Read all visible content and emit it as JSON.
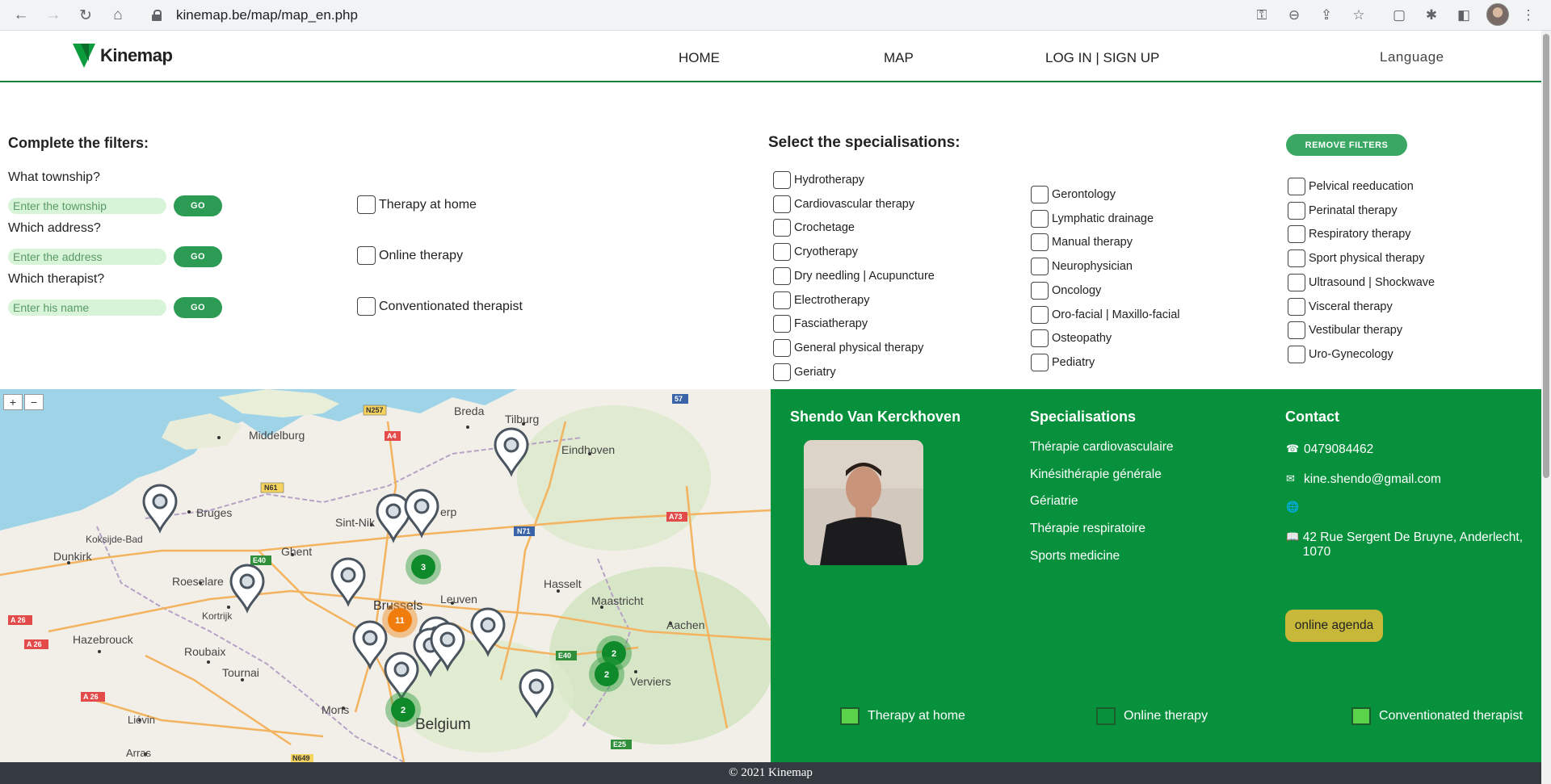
{
  "browser": {
    "url": "kinemap.be/map/map_en.php"
  },
  "header": {
    "logo_text": "Kinemap",
    "nav": [
      "HOME",
      "MAP",
      "LOG IN | SIGN UP"
    ],
    "language": "Language"
  },
  "filters": {
    "title": "Complete the filters:",
    "township_label": "What township?",
    "township_placeholder": "Enter the township",
    "address_label": "Which address?",
    "address_placeholder": "Enter the address",
    "therapist_label": "Which therapist?",
    "therapist_placeholder": "Enter his name",
    "go_label": "GO",
    "options": [
      "Therapy at home",
      "Online therapy",
      "Conventionated therapist"
    ]
  },
  "specialisations": {
    "title": "Select the specialisations:",
    "remove_label": "REMOVE FILTERS",
    "col1": [
      "Hydrotherapy",
      "Cardiovascular therapy",
      "Crochetage",
      "Cryotherapy",
      "Dry needling | Acupuncture",
      "Electrotherapy",
      "Fasciatherapy",
      "General physical therapy",
      "Geriatry"
    ],
    "col2": [
      "Gerontology",
      "Lymphatic drainage",
      "Manual therapy",
      "Neurophysician",
      "Oncology",
      "Oro-facial | Maxillo-facial",
      "Osteopathy",
      "Pediatry"
    ],
    "col3": [
      "Pelvical reeducation",
      "Perinatal therapy",
      "Respiratory therapy",
      "Sport physical therapy",
      "Ultrasound | Shockwave",
      "Visceral therapy",
      "Vestibular therapy",
      "Uro-Gynecology"
    ]
  },
  "map": {
    "zoom_in": "+",
    "zoom_out": "−",
    "places": [
      {
        "name": "Breda"
      },
      {
        "name": "Tilburg"
      },
      {
        "name": "Middelburg"
      },
      {
        "name": "Eindhoven"
      },
      {
        "name": "Bruges"
      },
      {
        "name": "Koksijde-Bad"
      },
      {
        "name": "Sint-Nik"
      },
      {
        "name": "erp"
      },
      {
        "name": "Ghent"
      },
      {
        "name": "Dunkirk"
      },
      {
        "name": "Roeselare"
      },
      {
        "name": "Kortrijk"
      },
      {
        "name": "Brussels"
      },
      {
        "name": "Leuven"
      },
      {
        "name": "Hasselt"
      },
      {
        "name": "Maastricht"
      },
      {
        "name": "Aachen"
      },
      {
        "name": "Hazebrouck"
      },
      {
        "name": "Roubaix"
      },
      {
        "name": "Tournai"
      },
      {
        "name": "Verviers"
      },
      {
        "name": "Mons"
      },
      {
        "name": "Liévin"
      },
      {
        "name": "Arras"
      },
      {
        "name": "Belgium"
      }
    ],
    "road_labels": [
      "N257",
      "A4",
      "N61",
      "E40",
      "N71",
      "A73",
      "A 26",
      "A 26",
      "A 26",
      "E40",
      "E25",
      "57",
      "N649"
    ],
    "clusters": [
      "3",
      "11",
      "2",
      "2",
      "2"
    ]
  },
  "therapist": {
    "name": "Shendo Van Kerckhoven",
    "spec_heading": "Specialisations",
    "specs": [
      "Thérapie cardiovasculaire",
      "Kinésithérapie générale",
      "Gériatrie",
      "Thérapie respiratoire",
      "Sports medicine"
    ],
    "contact_heading": "Contact",
    "phone": "0479084462",
    "email": "kine.shendo@gmail.com",
    "address": "42 Rue Sergent De Bruyne, Anderlecht, 1070",
    "agenda_label": "online agenda",
    "features": [
      "Therapy at home",
      "Online therapy",
      "Conventionated therapist"
    ],
    "feature_on_color": "#5ad34a",
    "feature_off_color": "#07913d"
  },
  "footer": {
    "text": "© 2021 Kinemap"
  }
}
